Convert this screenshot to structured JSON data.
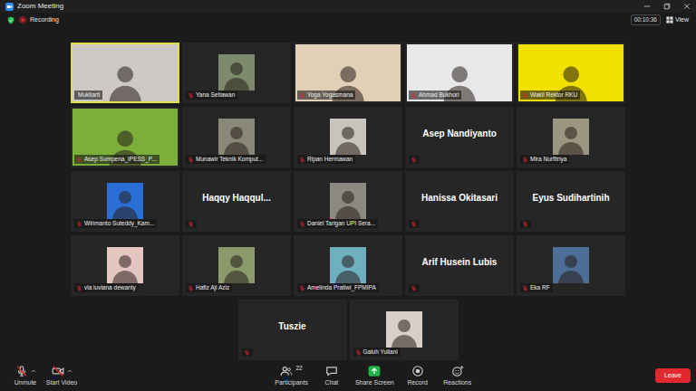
{
  "window": {
    "title": "Zoom Meeting"
  },
  "top_bar": {
    "recording": {
      "label": "Recording",
      "on": true
    },
    "timer": "00:10:36",
    "view": "View"
  },
  "participants": [
    {
      "name": "Mukliarti",
      "kind": "video",
      "muted": false,
      "speaking": true
    },
    {
      "name": "Yana Setiawan",
      "kind": "photo",
      "muted": true,
      "speaking": false
    },
    {
      "name": "Yoga Yogasmana",
      "kind": "video",
      "muted": true,
      "speaking": false
    },
    {
      "name": "Ahmad Bukhori",
      "kind": "video",
      "muted": true,
      "speaking": false
    },
    {
      "name": "Wakil Rektor RKU",
      "kind": "video",
      "muted": true,
      "speaking": false
    },
    {
      "name": "Asep Sumpena_IPESS_P...",
      "kind": "video",
      "muted": true,
      "speaking": false
    },
    {
      "name": "Munawir Teknik Komput...",
      "kind": "photo",
      "muted": true,
      "speaking": false
    },
    {
      "name": "Ripan Hermawan",
      "kind": "photo",
      "muted": true,
      "speaking": false
    },
    {
      "name": "Asep Nandiyanto",
      "kind": "name",
      "muted": true,
      "speaking": false
    },
    {
      "name": "Mira Nurfitriya",
      "kind": "photo",
      "muted": true,
      "speaking": false
    },
    {
      "name": "Wirimanto Suteddy_Kam...",
      "kind": "photo",
      "muted": true,
      "speaking": false
    },
    {
      "name": "Haqqy  Haqqul...",
      "kind": "name",
      "muted": true,
      "speaking": false
    },
    {
      "name": "Daniel Tarigan UPI Sera...",
      "kind": "photo",
      "muted": true,
      "speaking": false
    },
    {
      "name": "Hanissa Okitasari",
      "kind": "name",
      "muted": true,
      "speaking": false
    },
    {
      "name": "Eyus Sudihartinih",
      "kind": "name",
      "muted": true,
      "speaking": false
    },
    {
      "name": "via luviana dewanty",
      "kind": "photo",
      "muted": true,
      "speaking": false
    },
    {
      "name": "Hafiz Aji Aziz",
      "kind": "photo",
      "muted": true,
      "speaking": false
    },
    {
      "name": "Amelinda Pratiwi_FPMIPA",
      "kind": "photo",
      "muted": true,
      "speaking": false
    },
    {
      "name": "Arif Husein Lubis",
      "kind": "name",
      "muted": true,
      "speaking": false
    },
    {
      "name": "Eka RF",
      "kind": "photo",
      "muted": true,
      "speaking": false
    },
    {
      "name": "Tuszie",
      "kind": "name",
      "muted": true,
      "speaking": false
    },
    {
      "name": "Galuh Yuliani",
      "kind": "photo",
      "muted": true,
      "speaking": false
    }
  ],
  "toolbar": {
    "audio": {
      "label": "Unmute",
      "muted": true
    },
    "video": {
      "label": "Start Video",
      "on": false
    },
    "participants": {
      "label": "Participants",
      "count": "22"
    },
    "chat": {
      "label": "Chat"
    },
    "share": {
      "label": "Share Screen"
    },
    "record": {
      "label": "Record"
    },
    "reactions": {
      "label": "Reactions"
    },
    "leave": {
      "label": "Leave"
    }
  }
}
